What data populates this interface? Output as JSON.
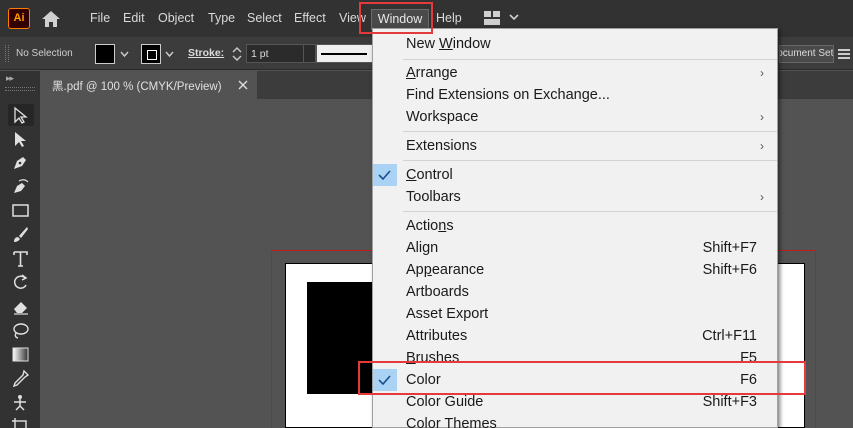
{
  "app": {
    "logo_text": "Ai",
    "brand_color": "#FF9A00"
  },
  "menubar": {
    "items": [
      "File",
      "Edit",
      "Object",
      "Type",
      "Select",
      "Effect",
      "View",
      "Window",
      "Help"
    ],
    "active_item": "Window"
  },
  "control_bar": {
    "selection_label": "No Selection",
    "fill_color": "#000000",
    "stroke_label": "Stroke:",
    "stroke_weight": "1 pt",
    "document_setup_label": "Document Setup"
  },
  "document_tab": {
    "title": "黑.pdf @ 100 % (CMYK/Preview)",
    "close_symbol": "×"
  },
  "tools": [
    "selection-tool",
    "direct-selection-tool",
    "pen-tool",
    "curvature-tool",
    "rectangle-tool",
    "paintbrush-tool",
    "type-tool",
    "rotate-tool",
    "eraser-tool",
    "lasso-tool",
    "gradient-tool",
    "eyedropper-tool",
    "puppet-warp-tool",
    "artboard-tool"
  ],
  "window_menu": {
    "items": [
      {
        "label_pre": "New ",
        "label_u": "W",
        "label_post": "indow",
        "shortcut": "",
        "submenu": false,
        "checked": false
      },
      {
        "label_pre": "",
        "label_u": "A",
        "label_post": "rrange",
        "shortcut": "",
        "submenu": true,
        "checked": false
      },
      {
        "label_pre": "Find Extensions on Exchange...",
        "label_u": "",
        "label_post": "",
        "shortcut": "",
        "submenu": false,
        "checked": false
      },
      {
        "label_pre": "Workspace",
        "label_u": "",
        "label_post": "",
        "shortcut": "",
        "submenu": true,
        "checked": false
      },
      {
        "label_pre": "Extensions",
        "label_u": "",
        "label_post": "",
        "shortcut": "",
        "submenu": true,
        "checked": false
      },
      {
        "label_pre": "",
        "label_u": "C",
        "label_post": "ontrol",
        "shortcut": "",
        "submenu": false,
        "checked": true
      },
      {
        "label_pre": "Toolbars",
        "label_u": "",
        "label_post": "",
        "shortcut": "",
        "submenu": true,
        "checked": false
      },
      {
        "label_pre": "Actio",
        "label_u": "n",
        "label_post": "s",
        "shortcut": "",
        "submenu": false,
        "checked": false
      },
      {
        "label_pre": "Align",
        "label_u": "",
        "label_post": "",
        "shortcut": "Shift+F7",
        "submenu": false,
        "checked": false
      },
      {
        "label_pre": "Ap",
        "label_u": "p",
        "label_post": "earance",
        "shortcut": "Shift+F6",
        "submenu": false,
        "checked": false
      },
      {
        "label_pre": "Artboards",
        "label_u": "",
        "label_post": "",
        "shortcut": "",
        "submenu": false,
        "checked": false
      },
      {
        "label_pre": "Asset Export",
        "label_u": "",
        "label_post": "",
        "shortcut": "",
        "submenu": false,
        "checked": false
      },
      {
        "label_pre": "Attributes",
        "label_u": "",
        "label_post": "",
        "shortcut": "Ctrl+F11",
        "submenu": false,
        "checked": false
      },
      {
        "label_pre": "",
        "label_u": "B",
        "label_post": "rushes",
        "shortcut": "F5",
        "submenu": false,
        "checked": false
      },
      {
        "label_pre": "Color",
        "label_u": "",
        "label_post": "",
        "shortcut": "F6",
        "submenu": false,
        "checked": true
      },
      {
        "label_pre": "Color Guide",
        "label_u": "",
        "label_post": "",
        "shortcut": "Shift+F3",
        "submenu": false,
        "checked": false
      },
      {
        "label_pre": "Color Themes",
        "label_u": "",
        "label_post": "",
        "shortcut": "",
        "submenu": false,
        "checked": false
      }
    ],
    "submenu_arrow": "›"
  },
  "annotation_color": "#E53A3A"
}
